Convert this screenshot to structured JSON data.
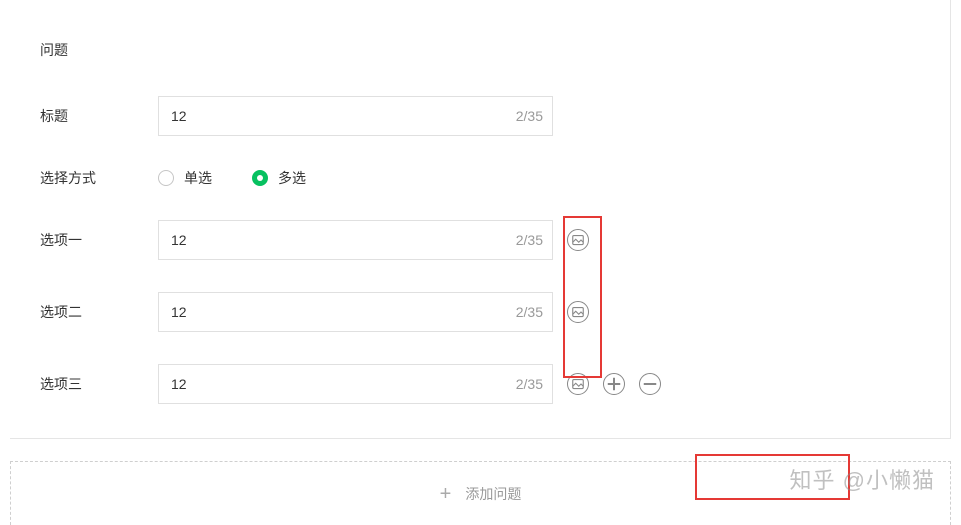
{
  "form": {
    "question_label": "问题",
    "title_label": "标题",
    "title_value": "12",
    "title_counter": "2/35",
    "select_mode_label": "选择方式",
    "radio_single": "单选",
    "radio_multi": "多选",
    "options": [
      {
        "label": "选项一",
        "value": "12",
        "counter": "2/35"
      },
      {
        "label": "选项二",
        "value": "12",
        "counter": "2/35"
      },
      {
        "label": "选项三",
        "value": "12",
        "counter": "2/35"
      }
    ]
  },
  "add_button_label": "添加问题",
  "watermark": "知乎 @小懒猫"
}
